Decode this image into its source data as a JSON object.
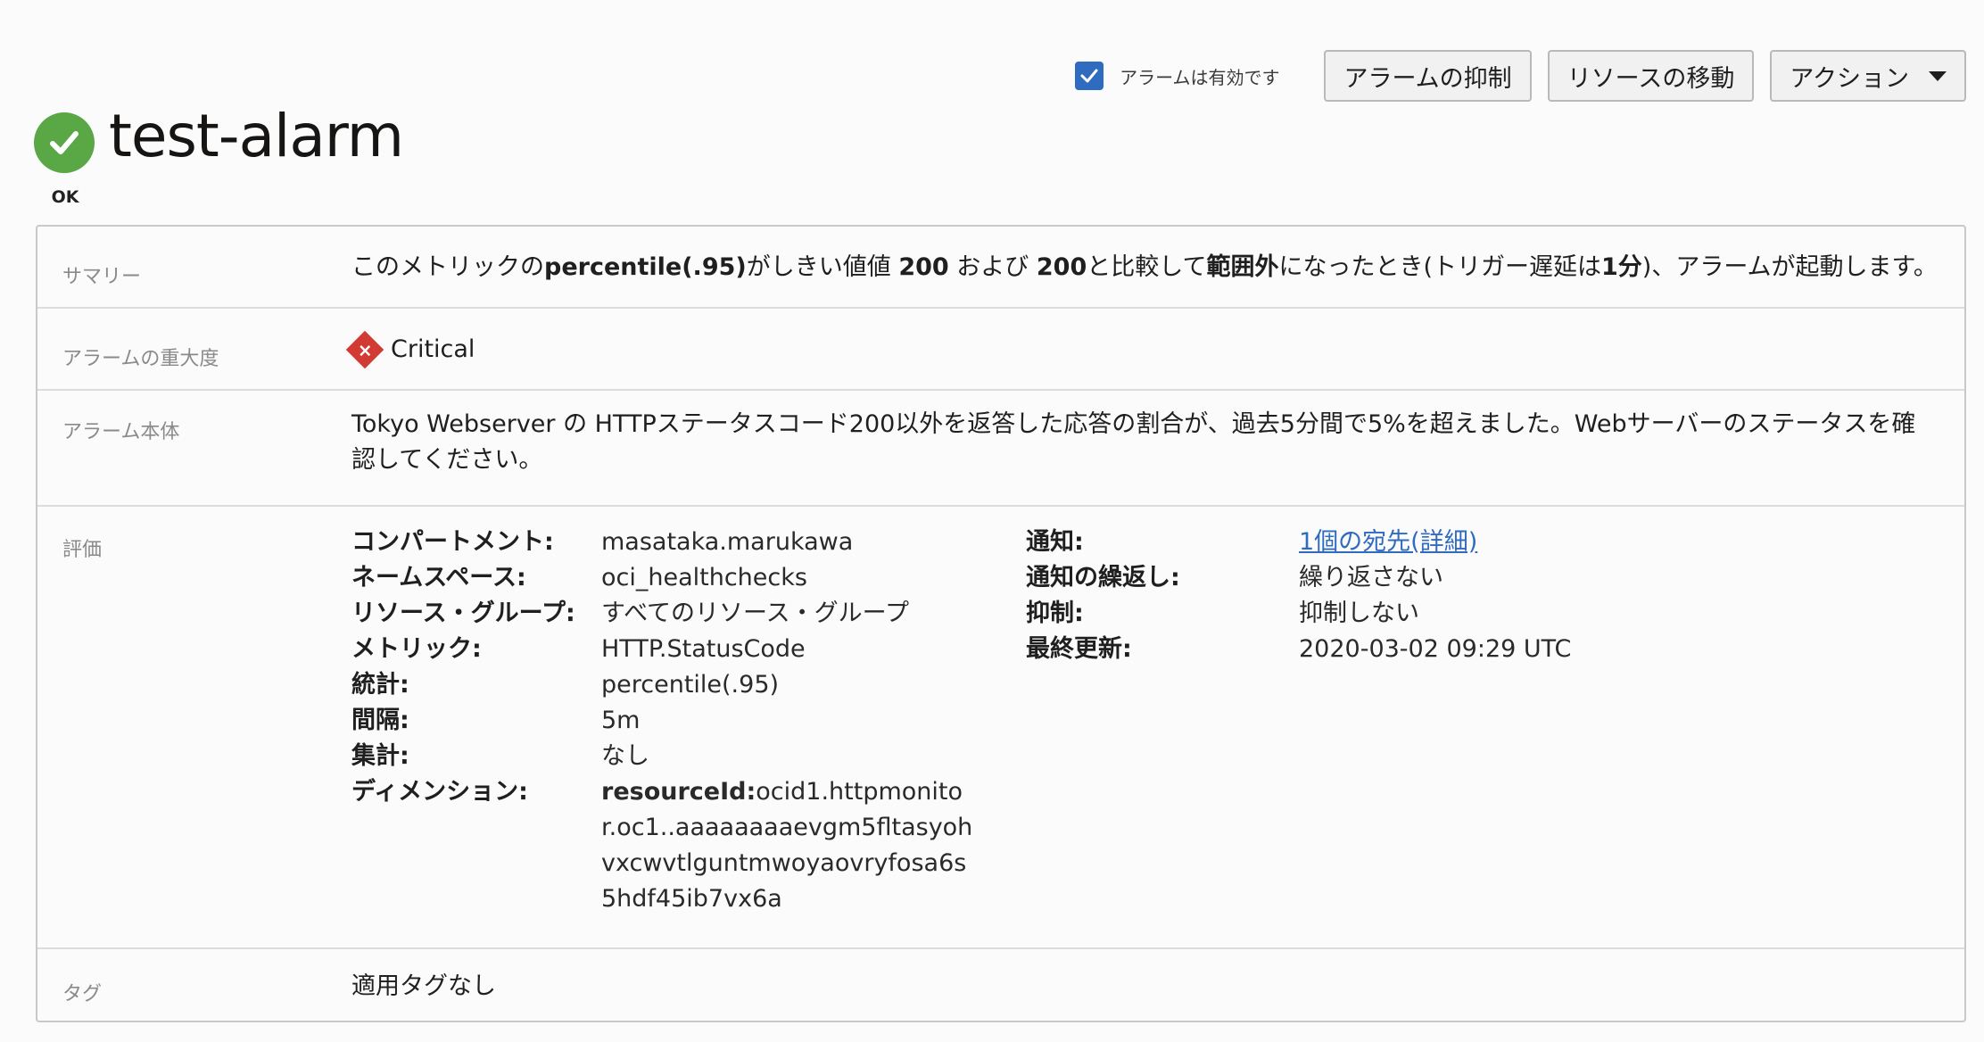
{
  "toolbar": {
    "enabled_label": "アラームは有効です",
    "enabled_checked": true,
    "suppress_button": "アラームの抑制",
    "move_button": "リソースの移動",
    "actions_button": "アクション"
  },
  "header": {
    "title": "test-alarm",
    "status": "OK",
    "status_color": "#5aa845"
  },
  "summary": {
    "label": "サマリー",
    "parts": {
      "p1": "このメトリックの",
      "b1": "percentile(.95)",
      "p2": "がしきい値値 ",
      "b2": "200",
      "p3": " および ",
      "b3": "200",
      "p4": "と比較して",
      "b4": "範囲外",
      "p5": "になったとき(トリガー遅延は",
      "b5": "1分",
      "p6": ")、アラームが起動します。"
    }
  },
  "severity": {
    "label": "アラームの重大度",
    "icon": "critical-x-icon",
    "value": "Critical",
    "color": "#d13b34"
  },
  "body": {
    "label": "アラーム本体",
    "text": "Tokyo Webserver の HTTPステータスコード200以外を返答した応答の割合が、過去5分間で5%を超えました。Webサーバーのステータスを確認してください。"
  },
  "evaluation": {
    "label": "評価",
    "left": [
      {
        "key": "コンパートメント:",
        "value": "masataka.marukawa"
      },
      {
        "key": "ネームスペース:",
        "value": "oci_healthchecks"
      },
      {
        "key": "リソース・グループ:",
        "value": "すべてのリソース・グループ"
      },
      {
        "key": "メトリック:",
        "value": "HTTP.StatusCode"
      },
      {
        "key": "統計:",
        "value": "percentile(.95)"
      },
      {
        "key": "間隔:",
        "value": "5m"
      },
      {
        "key": "集計:",
        "value": "なし"
      }
    ],
    "dimension": {
      "key": "ディメンション:",
      "name": "resourceId:",
      "value": "ocid1.httpmonitor.oc1..aaaaaaaaevgm5fltasyohvxcwvtlguntmwoyaovryfosa6s5hdf45ib7vx6a"
    },
    "right": {
      "notifications_key": "通知:",
      "notifications_link": "1個の宛先(詳細)",
      "repeat_key": "通知の繰返し:",
      "repeat_value": "繰り返さない",
      "suppress_key": "抑制:",
      "suppress_value": "抑制しない",
      "updated_key": "最終更新:",
      "updated_value": "2020-03-02 09:29 UTC"
    }
  },
  "tags": {
    "label": "タグ",
    "value": "適用タグなし"
  }
}
